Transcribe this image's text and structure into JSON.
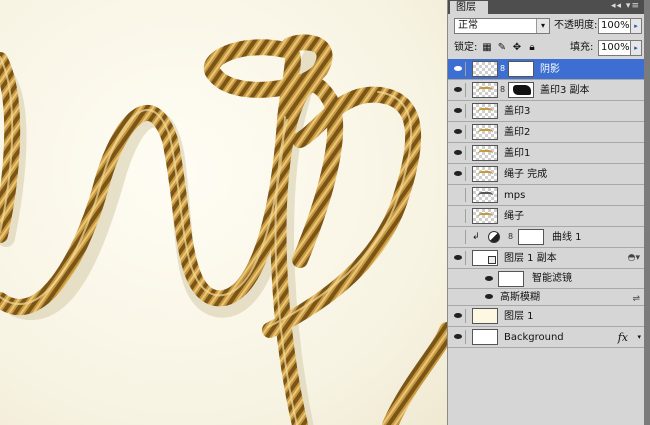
{
  "panel": {
    "tab_label": "图层",
    "tab_icons": "◂◂ ▾≡",
    "blend_mode": "正常",
    "opacity_label": "不透明度:",
    "opacity_value": "100%",
    "lock_label": "锁定:",
    "fill_label": "填充:",
    "fill_value": "100%",
    "arrow_glyph": "▸",
    "dropdown_glyph": "▾"
  },
  "layers": [
    {
      "name": "阴影",
      "thumb": "checker",
      "mask": "white",
      "selected": true
    },
    {
      "name": "盖印3 副本",
      "thumb": "checker",
      "mask": "black",
      "selected": false
    },
    {
      "name": "盖印3",
      "thumb": "checker",
      "selected": false
    },
    {
      "name": "盖印2",
      "thumb": "checker",
      "selected": false
    },
    {
      "name": "盖印1",
      "thumb": "checker",
      "selected": false
    },
    {
      "name": "绳子 完成",
      "thumb": "checker",
      "selected": false
    },
    {
      "name": "mps",
      "thumb": "checker",
      "selected": false,
      "hidden": true
    },
    {
      "name": "绳子",
      "thumb": "checker",
      "selected": false,
      "hidden": true
    },
    {
      "name": "曲线 1",
      "thumb": "adjust",
      "mask": "white",
      "selected": false,
      "hidden": true
    },
    {
      "name": "图层 1 副本",
      "thumb": "smart",
      "selected": false
    },
    {
      "name": "智能滤镜",
      "thumb": "white",
      "selected": false,
      "sub": true
    },
    {
      "name": "高斯模糊",
      "selected": false,
      "sub": true
    },
    {
      "name": "图层 1",
      "thumb": "cream",
      "selected": false
    },
    {
      "name": "Background",
      "thumb": "white",
      "fx": "fx",
      "selected": false
    }
  ]
}
